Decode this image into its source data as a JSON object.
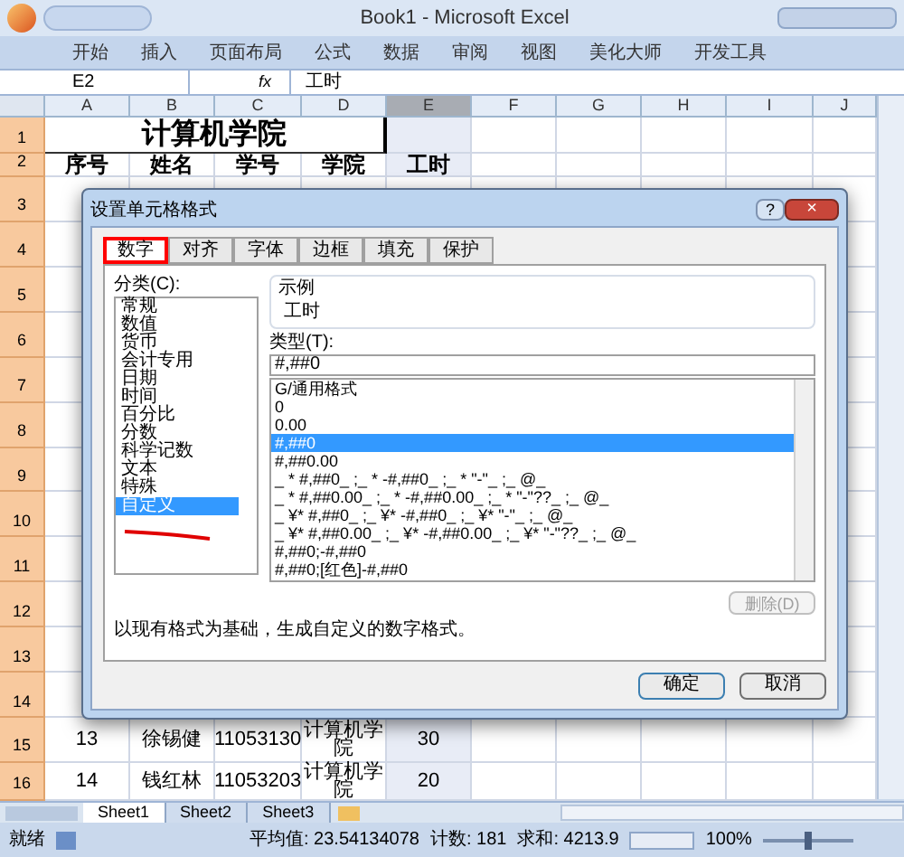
{
  "window": {
    "title": "Book1 - Microsoft Excel"
  },
  "ribbon_tabs": [
    "开始",
    "插入",
    "页面布局",
    "公式",
    "数据",
    "审阅",
    "视图",
    "美化大师",
    "开发工具"
  ],
  "formula_bar": {
    "name_box": "E2",
    "fx": "fx",
    "value": "工时"
  },
  "columns": [
    {
      "label": "A",
      "selected": false
    },
    {
      "label": "B",
      "selected": false
    },
    {
      "label": "C",
      "selected": false
    },
    {
      "label": "D",
      "selected": false
    },
    {
      "label": "E",
      "selected": true
    },
    {
      "label": "F",
      "selected": false
    },
    {
      "label": "G",
      "selected": false
    },
    {
      "label": "H",
      "selected": false
    },
    {
      "label": "I",
      "selected": false
    },
    {
      "label": "J",
      "selected": false
    }
  ],
  "rows": [
    {
      "number": "1",
      "kind": "title",
      "title": "计算机学院"
    },
    {
      "number": "2",
      "kind": "header",
      "cells": [
        "序号",
        "姓名",
        "学号",
        "学院",
        "工时"
      ]
    },
    {
      "number": "3",
      "kind": "hidden"
    },
    {
      "number": "4",
      "kind": "hidden"
    },
    {
      "number": "5",
      "kind": "hidden"
    },
    {
      "number": "6",
      "kind": "hidden"
    },
    {
      "number": "7",
      "kind": "hidden"
    },
    {
      "number": "8",
      "kind": "hidden"
    },
    {
      "number": "9",
      "kind": "hidden"
    },
    {
      "number": "10",
      "kind": "hidden"
    },
    {
      "number": "11",
      "kind": "hidden"
    },
    {
      "number": "12",
      "kind": "hidden"
    },
    {
      "number": "13",
      "kind": "hidden"
    },
    {
      "number": "14",
      "kind": "hidden"
    },
    {
      "number": "15",
      "kind": "data",
      "cells": [
        "13",
        "徐锡健",
        "11053130",
        "计算机学院",
        "30"
      ]
    },
    {
      "number": "16",
      "kind": "data",
      "cells": [
        "14",
        "钱红林",
        "11053203",
        "计算机学院",
        "20"
      ]
    }
  ],
  "sheet_tabs": [
    {
      "label": "Sheet1",
      "selected": true
    },
    {
      "label": "Sheet2",
      "selected": false
    },
    {
      "label": "Sheet3",
      "selected": false
    }
  ],
  "status_bar": {
    "ready": "就绪",
    "average": "平均值: 23.54134078",
    "count": "计数: 181",
    "sum": "求和: 4213.9",
    "zoom": "100%",
    "zoom_slider": {
      "level": 0.5
    }
  },
  "dialog": {
    "title": "设置单元格格式",
    "help": "?",
    "close": "×",
    "tabs": [
      {
        "label": "数字",
        "selected": true
      },
      {
        "label": "对齐",
        "selected": false
      },
      {
        "label": "字体",
        "selected": false
      },
      {
        "label": "边框",
        "selected": false
      },
      {
        "label": "填充",
        "selected": false
      },
      {
        "label": "保护",
        "selected": false
      }
    ],
    "category_label": "分类(C):",
    "categories": [
      {
        "label": "常规",
        "selected": false
      },
      {
        "label": "数值",
        "selected": false
      },
      {
        "label": "货币",
        "selected": false
      },
      {
        "label": "会计专用",
        "selected": false
      },
      {
        "label": "日期",
        "selected": false
      },
      {
        "label": "时间",
        "selected": false
      },
      {
        "label": "百分比",
        "selected": false
      },
      {
        "label": "分数",
        "selected": false
      },
      {
        "label": "科学记数",
        "selected": false
      },
      {
        "label": "文本",
        "selected": false
      },
      {
        "label": "特殊",
        "selected": false
      },
      {
        "label": "自定义",
        "selected": true
      }
    ],
    "sample_label": "示例",
    "sample_value": "工时",
    "type_label": "类型(T):",
    "type_value": "#,##0",
    "formats": [
      {
        "label": "G/通用格式",
        "selected": false
      },
      {
        "label": "0",
        "selected": false
      },
      {
        "label": "0.00",
        "selected": false
      },
      {
        "label": "#,##0",
        "selected": true
      },
      {
        "label": "#,##0.00",
        "selected": false
      },
      {
        "label": "_ * #,##0_ ;_ * -#,##0_ ;_ * \"-\"_ ;_ @_",
        "selected": false
      },
      {
        "label": "_ * #,##0.00_ ;_ * -#,##0.00_ ;_ * \"-\"??_ ;_ @_",
        "selected": false
      },
      {
        "label": "_ ¥* #,##0_ ;_ ¥* -#,##0_ ;_ ¥* \"-\"_ ;_ @_",
        "selected": false
      },
      {
        "label": "_ ¥* #,##0.00_ ;_ ¥* -#,##0.00_ ;_ ¥* \"-\"??_ ;_ @_",
        "selected": false
      },
      {
        "label": "#,##0;-#,##0",
        "selected": false
      },
      {
        "label": "#,##0;[红色]-#,##0",
        "selected": false
      }
    ],
    "delete_button": {
      "label": "删除(D)",
      "disabled": true
    },
    "description": "以现有格式为基础，生成自定义的数字格式。",
    "buttons": [
      "确定",
      "取消"
    ]
  }
}
